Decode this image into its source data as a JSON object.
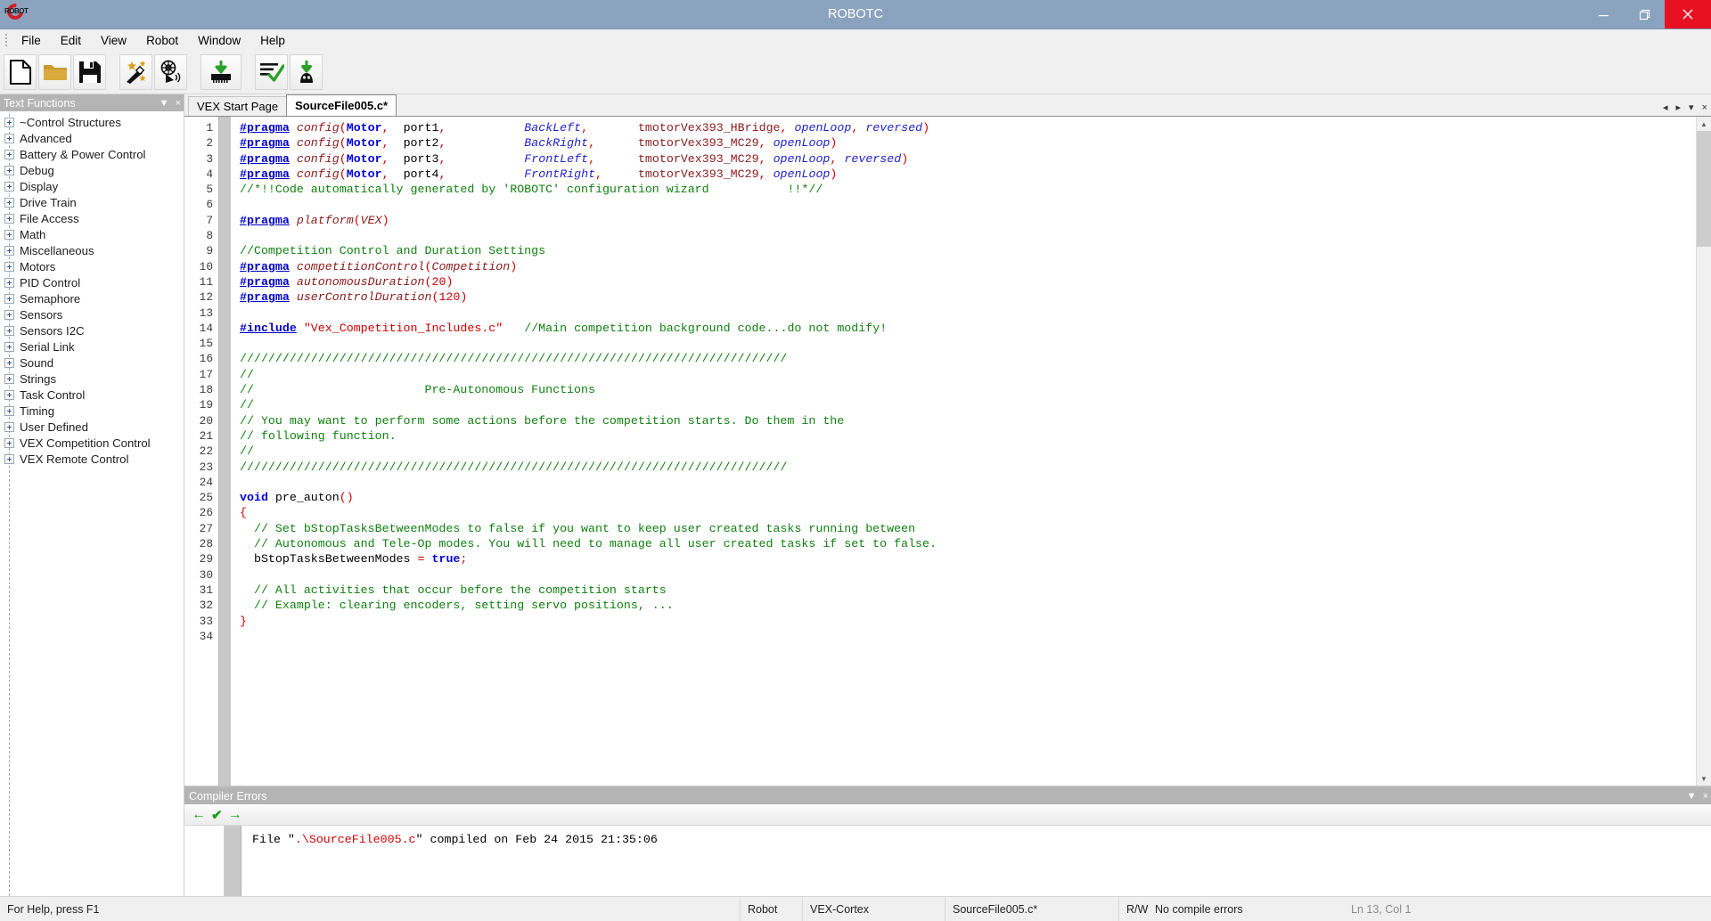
{
  "window": {
    "title": "ROBOTC",
    "logo_text": "ROBOT",
    "minimize_label": "Minimize",
    "maximize_label": "Restore",
    "close_label": "Close"
  },
  "menubar": {
    "items": [
      {
        "label": "File"
      },
      {
        "label": "Edit"
      },
      {
        "label": "View"
      },
      {
        "label": "Robot"
      },
      {
        "label": "Window"
      },
      {
        "label": "Help"
      }
    ]
  },
  "toolbar": {
    "buttons": [
      {
        "name": "new-file-button",
        "icon": "new-file-icon",
        "title": "New File"
      },
      {
        "name": "open-file-button",
        "icon": "open-folder-icon",
        "title": "Open File"
      },
      {
        "name": "save-file-button",
        "icon": "save-floppy-icon",
        "title": "Save File"
      },
      {
        "name": "motors-sensors-setup-button",
        "icon": "magic-wand-icon",
        "title": "Motors and Sensors Setup"
      },
      {
        "name": "vex-remote-button",
        "icon": "remote-antenna-icon",
        "title": "VEX Remote Screen"
      },
      {
        "name": "download-firmware-button",
        "icon": "download-chip-icon",
        "title": "Download Firmware"
      },
      {
        "name": "compile-program-button",
        "icon": "compile-check-icon",
        "title": "Compile Program"
      },
      {
        "name": "download-program-button",
        "icon": "download-robot-icon",
        "title": "Download to Robot"
      }
    ]
  },
  "left_panel": {
    "title": "Text Functions",
    "collapse_glyph": "▼",
    "close_glyph": "×",
    "items": [
      {
        "label": "~Control Structures"
      },
      {
        "label": "Advanced"
      },
      {
        "label": "Battery & Power Control"
      },
      {
        "label": "Debug"
      },
      {
        "label": "Display"
      },
      {
        "label": "Drive Train"
      },
      {
        "label": "File Access"
      },
      {
        "label": "Math"
      },
      {
        "label": "Miscellaneous"
      },
      {
        "label": "Motors"
      },
      {
        "label": "PID Control"
      },
      {
        "label": "Semaphore"
      },
      {
        "label": "Sensors"
      },
      {
        "label": "Sensors I2C"
      },
      {
        "label": "Serial Link"
      },
      {
        "label": "Sound"
      },
      {
        "label": "Strings"
      },
      {
        "label": "Task Control"
      },
      {
        "label": "Timing"
      },
      {
        "label": "User Defined"
      },
      {
        "label": "VEX Competition Control"
      },
      {
        "label": "VEX Remote Control"
      }
    ]
  },
  "tabs": {
    "items": [
      {
        "label": "VEX Start Page",
        "active": false
      },
      {
        "label": "SourceFile005.c*",
        "active": true
      }
    ],
    "nav_prev": "◂",
    "nav_next": "▸",
    "list_glyph": "▾",
    "close_glyph": "×"
  },
  "editor": {
    "first_line": 1,
    "last_line": 34,
    "lines": [
      {
        "n": 1,
        "text": "#pragma config(Motor,  port1,           BackLeft,       tmotorVex393_HBridge, openLoop, reversed)"
      },
      {
        "n": 2,
        "text": "#pragma config(Motor,  port2,           BackRight,      tmotorVex393_MC29, openLoop)"
      },
      {
        "n": 3,
        "text": "#pragma config(Motor,  port3,           FrontLeft,      tmotorVex393_MC29, openLoop, reversed)"
      },
      {
        "n": 4,
        "text": "#pragma config(Motor,  port4,           FrontRight,     tmotorVex393_MC29, openLoop)"
      },
      {
        "n": 5,
        "text": "//*!!Code automatically generated by 'ROBOTC' configuration wizard           !!*//"
      },
      {
        "n": 6,
        "text": ""
      },
      {
        "n": 7,
        "text": "#pragma platform(VEX)"
      },
      {
        "n": 8,
        "text": ""
      },
      {
        "n": 9,
        "text": "//Competition Control and Duration Settings"
      },
      {
        "n": 10,
        "text": "#pragma competitionControl(Competition)"
      },
      {
        "n": 11,
        "text": "#pragma autonomousDuration(20)"
      },
      {
        "n": 12,
        "text": "#pragma userControlDuration(120)"
      },
      {
        "n": 13,
        "text": ""
      },
      {
        "n": 14,
        "text": "#include \"Vex_Competition_Includes.c\"   //Main competition background code...do not modify!"
      },
      {
        "n": 15,
        "text": ""
      },
      {
        "n": 16,
        "text": "/////////////////////////////////////////////////////////////////////////////"
      },
      {
        "n": 17,
        "text": "//"
      },
      {
        "n": 18,
        "text": "//                        Pre-Autonomous Functions"
      },
      {
        "n": 19,
        "text": "//"
      },
      {
        "n": 20,
        "text": "// You may want to perform some actions before the competition starts. Do them in the"
      },
      {
        "n": 21,
        "text": "// following function."
      },
      {
        "n": 22,
        "text": "//"
      },
      {
        "n": 23,
        "text": "/////////////////////////////////////////////////////////////////////////////"
      },
      {
        "n": 24,
        "text": ""
      },
      {
        "n": 25,
        "text": "void pre_auton()"
      },
      {
        "n": 26,
        "text": "{"
      },
      {
        "n": 27,
        "text": "  // Set bStopTasksBetweenModes to false if you want to keep user created tasks running between"
      },
      {
        "n": 28,
        "text": "  // Autonomous and Tele-Op modes. You will need to manage all user created tasks if set to false."
      },
      {
        "n": 29,
        "text": "  bStopTasksBetweenModes = true;"
      },
      {
        "n": 30,
        "text": ""
      },
      {
        "n": 31,
        "text": "  // All activities that occur before the competition starts"
      },
      {
        "n": 32,
        "text": "  // Example: clearing encoders, setting servo positions, ..."
      },
      {
        "n": 33,
        "text": "}"
      },
      {
        "n": 34,
        "text": ""
      }
    ]
  },
  "compiler_panel": {
    "title": "Compiler Errors",
    "collapse_glyph": "▼",
    "close_glyph": "×",
    "prev_error_label": "←",
    "check_label": "✔",
    "next_error_label": "→",
    "message_prefix": "File \"",
    "message_file": ".\\SourceFile005.c",
    "message_suffix": "\" compiled on Feb 24 2015 21:35:06"
  },
  "statusbar": {
    "help_text": "For Help, press F1",
    "robot_label": "Robot",
    "platform": "VEX-Cortex",
    "filename": "SourceFile005.c*",
    "rw_mode": "R/W",
    "compile_status": "No compile errors",
    "caret_position": "Ln 13, Col 1"
  },
  "colors": {
    "titlebar": "#8ba3be",
    "close_button": "#e81123",
    "panel_header": "#b4b4b4",
    "comment_green": "#108010",
    "keyword_blue": "#0000c8",
    "type_maroon": "#8b1a1a",
    "string_red": "#cc0000",
    "gutter_bar": "#c8c8c8"
  }
}
